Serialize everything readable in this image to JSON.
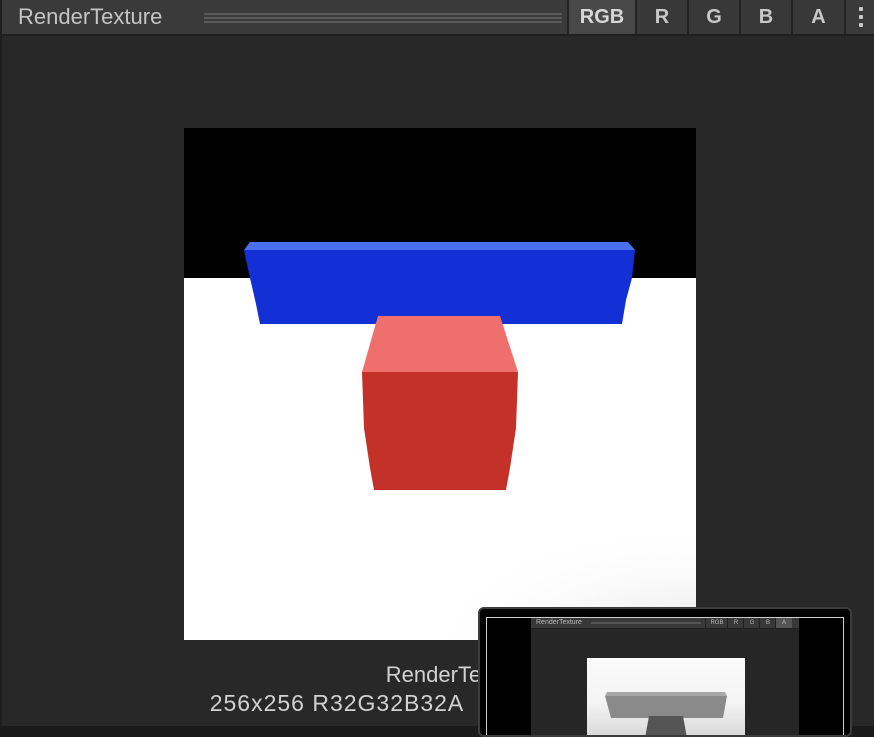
{
  "window": {
    "title": "RenderTexture"
  },
  "channels": [
    {
      "label": "RGB",
      "active": true
    },
    {
      "label": "R",
      "active": false
    },
    {
      "label": "G",
      "active": false
    },
    {
      "label": "B",
      "active": false
    },
    {
      "label": "A",
      "active": false
    }
  ],
  "menu_icon": "kebab-menu-icon",
  "info": {
    "name": "RenderTex",
    "format": "256x256  R32G32B32A"
  },
  "thumbnail": {
    "title": "RenderTexture",
    "channels": [
      "RGB",
      "R",
      "G",
      "B",
      "A"
    ],
    "active_channel": "A"
  },
  "colors": {
    "sky": "#000000",
    "ground": "#ffffff",
    "blue_front": "#1230d6",
    "blue_top": "#4a70f0",
    "red_front": "#c33129",
    "red_top": "#ee6f6b"
  }
}
